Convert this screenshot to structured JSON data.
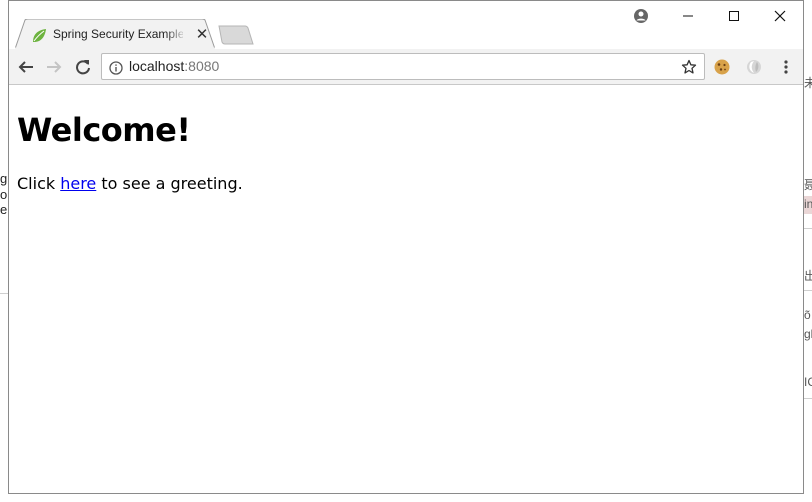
{
  "browser": {
    "tab": {
      "title": "Spring Security Example",
      "favicon": "spring-leaf-icon"
    },
    "address_bar": {
      "host": "localhost",
      "port": ":8080"
    },
    "icons": {
      "back": "arrow-left-icon",
      "forward": "arrow-right-icon",
      "reload": "reload-icon",
      "info": "info-icon",
      "bookmark": "star-icon",
      "profile": "profile-icon",
      "menu": "kebab-menu-icon"
    }
  },
  "page": {
    "heading": "Welcome!",
    "text_before_link": "Click ",
    "link_text": "here",
    "text_after_link": " to see a greeting."
  },
  "background_fragments": {
    "left": [
      "g",
      "or",
      "e"
    ],
    "right": [
      "未",
      "聂",
      "in",
      "出",
      "õ",
      "gl",
      "IC"
    ]
  },
  "colors": {
    "link": "#0000ee",
    "toolbar_bg": "#f2f2f2",
    "spring_green": "#6db33f"
  }
}
